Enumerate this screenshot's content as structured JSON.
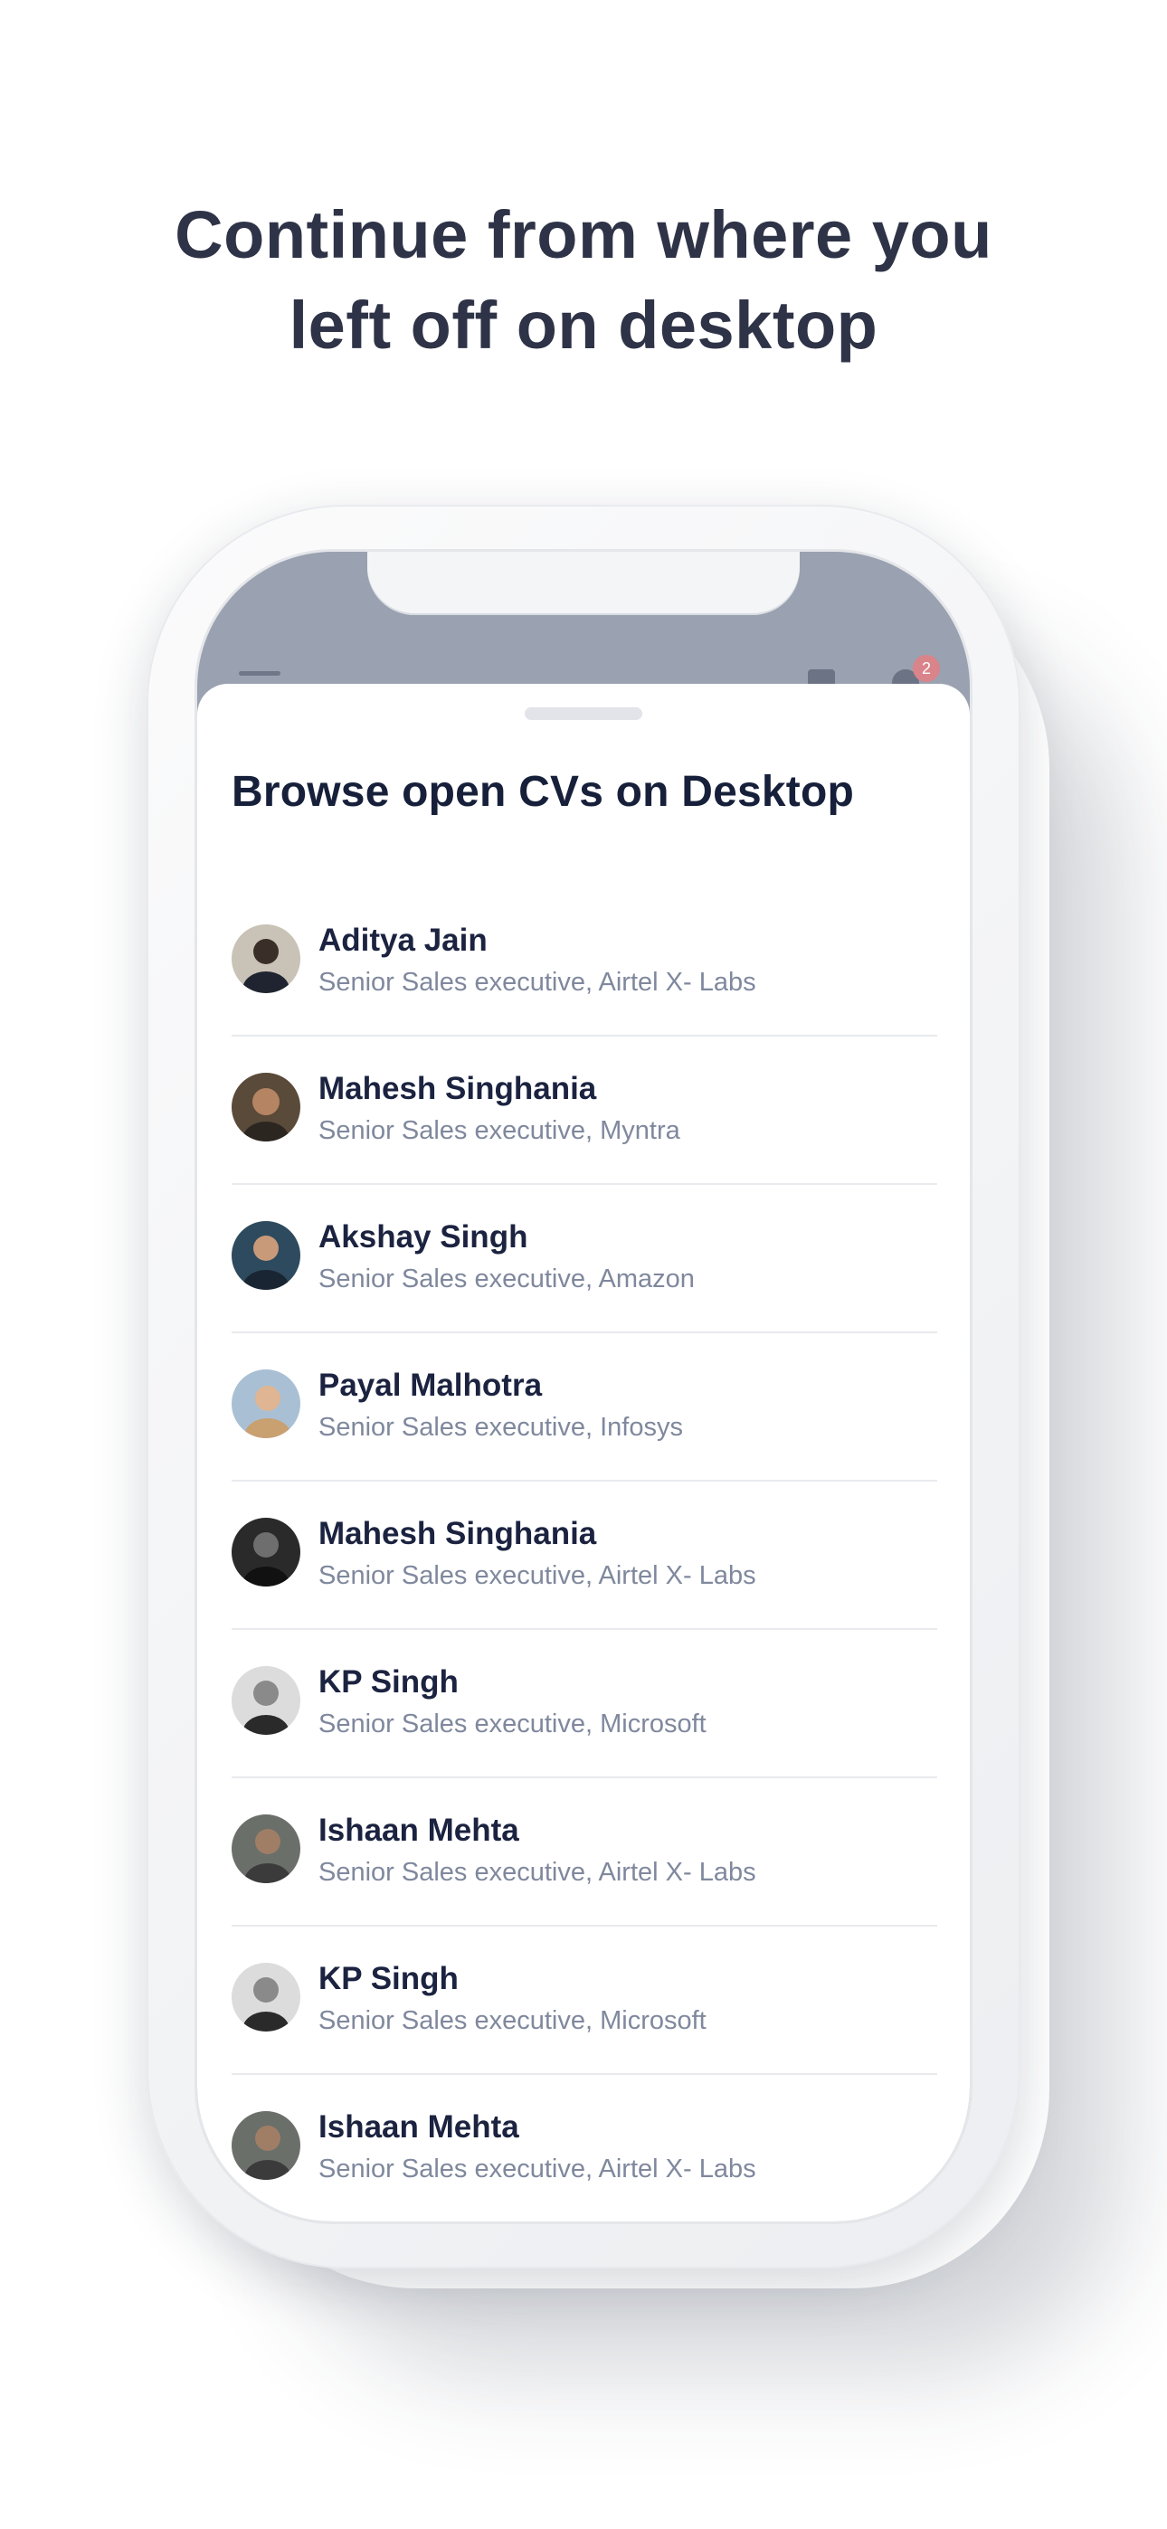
{
  "headline": {
    "line1": "Continue from where you",
    "line2": "left off on desktop"
  },
  "status_bar": {
    "notification_count": "2",
    "icons": [
      "hamburger-menu-icon",
      "square-icon",
      "bell-icon"
    ]
  },
  "sheet": {
    "title": "Browse open CVs on Desktop",
    "candidates": [
      {
        "name": "Aditya Jain",
        "role": "Senior Sales executive, Airtel X- Labs",
        "avatar_color": "#c9c2b6"
      },
      {
        "name": "Mahesh Singhania",
        "role": "Senior Sales executive, Myntra",
        "avatar_color": "#5a4a3a"
      },
      {
        "name": "Akshay Singh",
        "role": "Senior Sales executive, Amazon",
        "avatar_color": "#2e4a5e"
      },
      {
        "name": "Payal Malhotra",
        "role": "Senior Sales executive, Infosys",
        "avatar_color": "#a9bfd4"
      },
      {
        "name": "Mahesh Singhania",
        "role": "Senior Sales executive, Airtel X- Labs",
        "avatar_color": "#2a2a2a"
      },
      {
        "name": "KP Singh",
        "role": "Senior Sales executive, Microsoft",
        "avatar_color": "#dcdcdc"
      },
      {
        "name": "Ishaan Mehta",
        "role": "Senior Sales executive, Airtel X- Labs",
        "avatar_color": "#6a6f6a"
      },
      {
        "name": "KP Singh",
        "role": "Senior Sales executive, Microsoft",
        "avatar_color": "#dcdcdc"
      },
      {
        "name": "Ishaan Mehta",
        "role": "Senior Sales executive, Airtel X- Labs",
        "avatar_color": "#6a6f6a"
      }
    ]
  },
  "colors": {
    "headline": "#2f3347",
    "name_text": "#1b2340",
    "role_text": "#7f889d",
    "screen_bg": "#9aa1b0",
    "badge": "#d9848a"
  }
}
